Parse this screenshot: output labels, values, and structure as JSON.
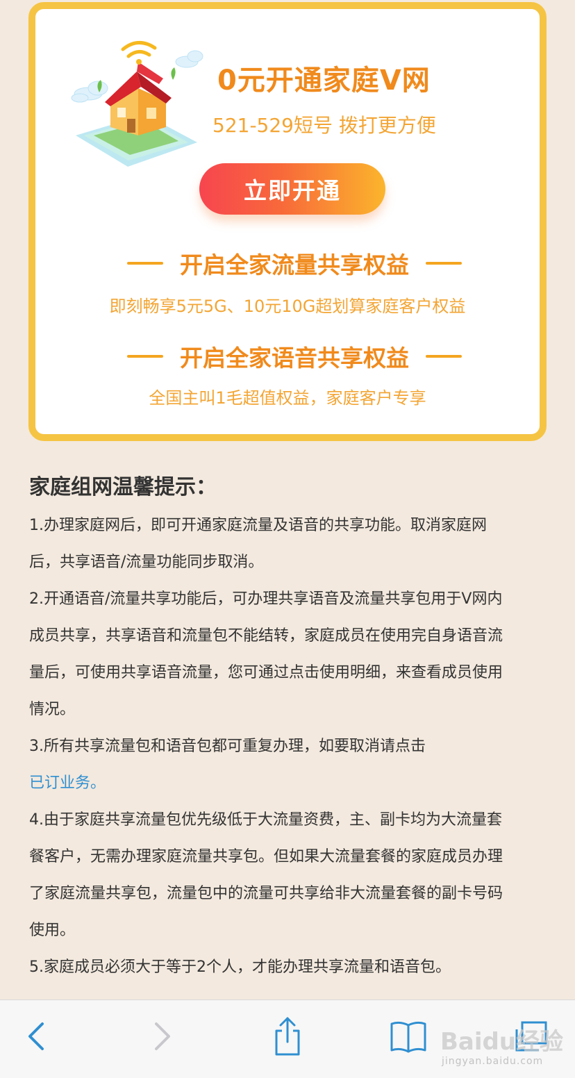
{
  "promo": {
    "title": "0元开通家庭V网",
    "subtitle": "521-529短号 拨打更方便",
    "button_label": "立即开通",
    "benefits": [
      {
        "heading": "开启全家流量共享权益",
        "description": "即刻畅享5元5G、10元10G超划算家庭客户权益"
      },
      {
        "heading": "开启全家语音共享权益",
        "description": "全国主叫1毛超值权益，家庭客户专享"
      }
    ]
  },
  "tips": {
    "title": "家庭组网温馨提示：",
    "lines": [
      "1.办理家庭网后，即可开通家庭流量及语音的共享功能。取消家庭网",
      "后，共享语音/流量功能同步取消。",
      "2.开通语音/流量共享功能后，可办理共享语音及流量共享包用于V网内",
      "成员共享，共享语音和流量包不能结转，家庭成员在使用完自身语音流",
      "量后，可使用共享语音流量，您可通过点击使用明细，来查看成员使用",
      "情况。",
      "3.所有共享流量包和语音包都可重复办理，如要取消请点击"
    ],
    "link_text": "已订业务。",
    "lines_after": [
      "4.由于家庭共享流量包优先级低于大流量资费，主、副卡均为大流量套",
      "餐客户，无需办理家庭流量共享包。但如果大流量套餐的家庭成员办理",
      "了家庭流量共享包，流量包中的流量可共享给非大流量套餐的副卡号码",
      "使用。",
      "5.家庭成员必须大于等于2个人，才能办理共享流量和语音包。"
    ]
  },
  "toolbar": {
    "icons": [
      "back-icon",
      "forward-icon",
      "share-icon",
      "bookmarks-icon",
      "tabs-icon"
    ],
    "watermark_text": "Baidu经验",
    "watermark_sub": "jingyan.baidu.com"
  },
  "colors": {
    "background": "#f3e9de",
    "card_border": "#f6c443",
    "title_orange": "#f08a1c",
    "subtitle_orange": "#f3a534",
    "link_blue": "#2f8fd1",
    "toolbar_blue": "#2f8fd1"
  }
}
